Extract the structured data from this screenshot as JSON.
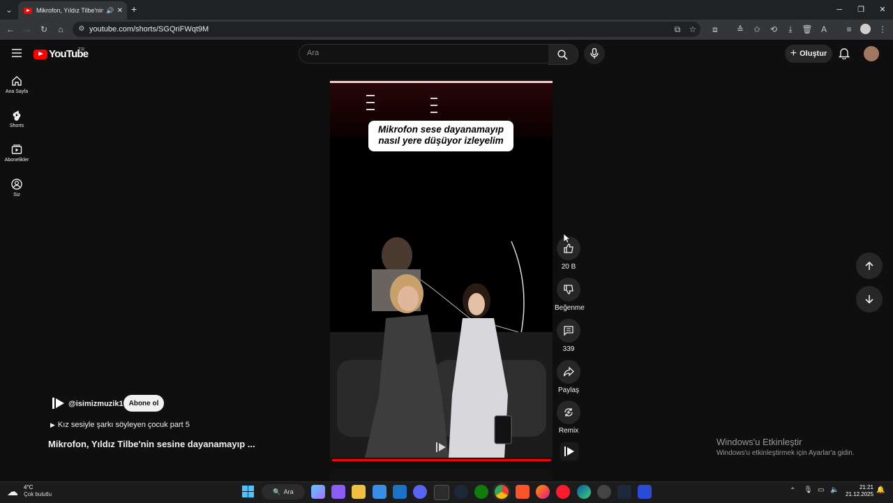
{
  "browser": {
    "tab_title": "Mikrofon, Yıldız Tilbe'nin se",
    "new_tab": "+",
    "url": "youtube.com/shorts/SGQriFWqt9M"
  },
  "header": {
    "logo_text": "YouTube",
    "region": "TR",
    "search_placeholder": "Ara",
    "create_label": "Oluştur"
  },
  "guide": [
    {
      "label": "Ana Sayfa",
      "icon": "home-icon"
    },
    {
      "label": "Shorts",
      "icon": "shorts-icon"
    },
    {
      "label": "Abonelikler",
      "icon": "subscriptions-icon"
    },
    {
      "label": "Siz",
      "icon": "account-icon"
    }
  ],
  "video": {
    "caption_line1": "Mikrofon sese dayanamayıp",
    "caption_line2": "nasıl yere düşüyor izleyelim",
    "progress_fraction": 1.0
  },
  "actions": {
    "like_count": "20 B",
    "dislike_label": "Beğenme",
    "comment_count": "339",
    "share_label": "Paylaş",
    "remix_label": "Remix"
  },
  "info": {
    "channel": "@isimizmuzik1",
    "subscribe_label": "Abone ol",
    "playlist": "Kız sesiyle şarkı söyleyen çocuk part 5",
    "title": "Mikrofon, Yıldız Tilbe'nin sesine dayanamayıp ..."
  },
  "watermark": {
    "heading": "Windows'u Etkinleştir",
    "sub": "Windows'u etkinleştirmek için Ayarlar'a gidin."
  },
  "taskbar": {
    "temp": "4°C",
    "weather": "Çok bulutlu",
    "search_label": "Ara",
    "time": "21:21",
    "date": "21.12.2025"
  },
  "colors": {
    "youtube_red": "#ff0000",
    "background": "#0f0f0f",
    "chip": "#272727"
  }
}
